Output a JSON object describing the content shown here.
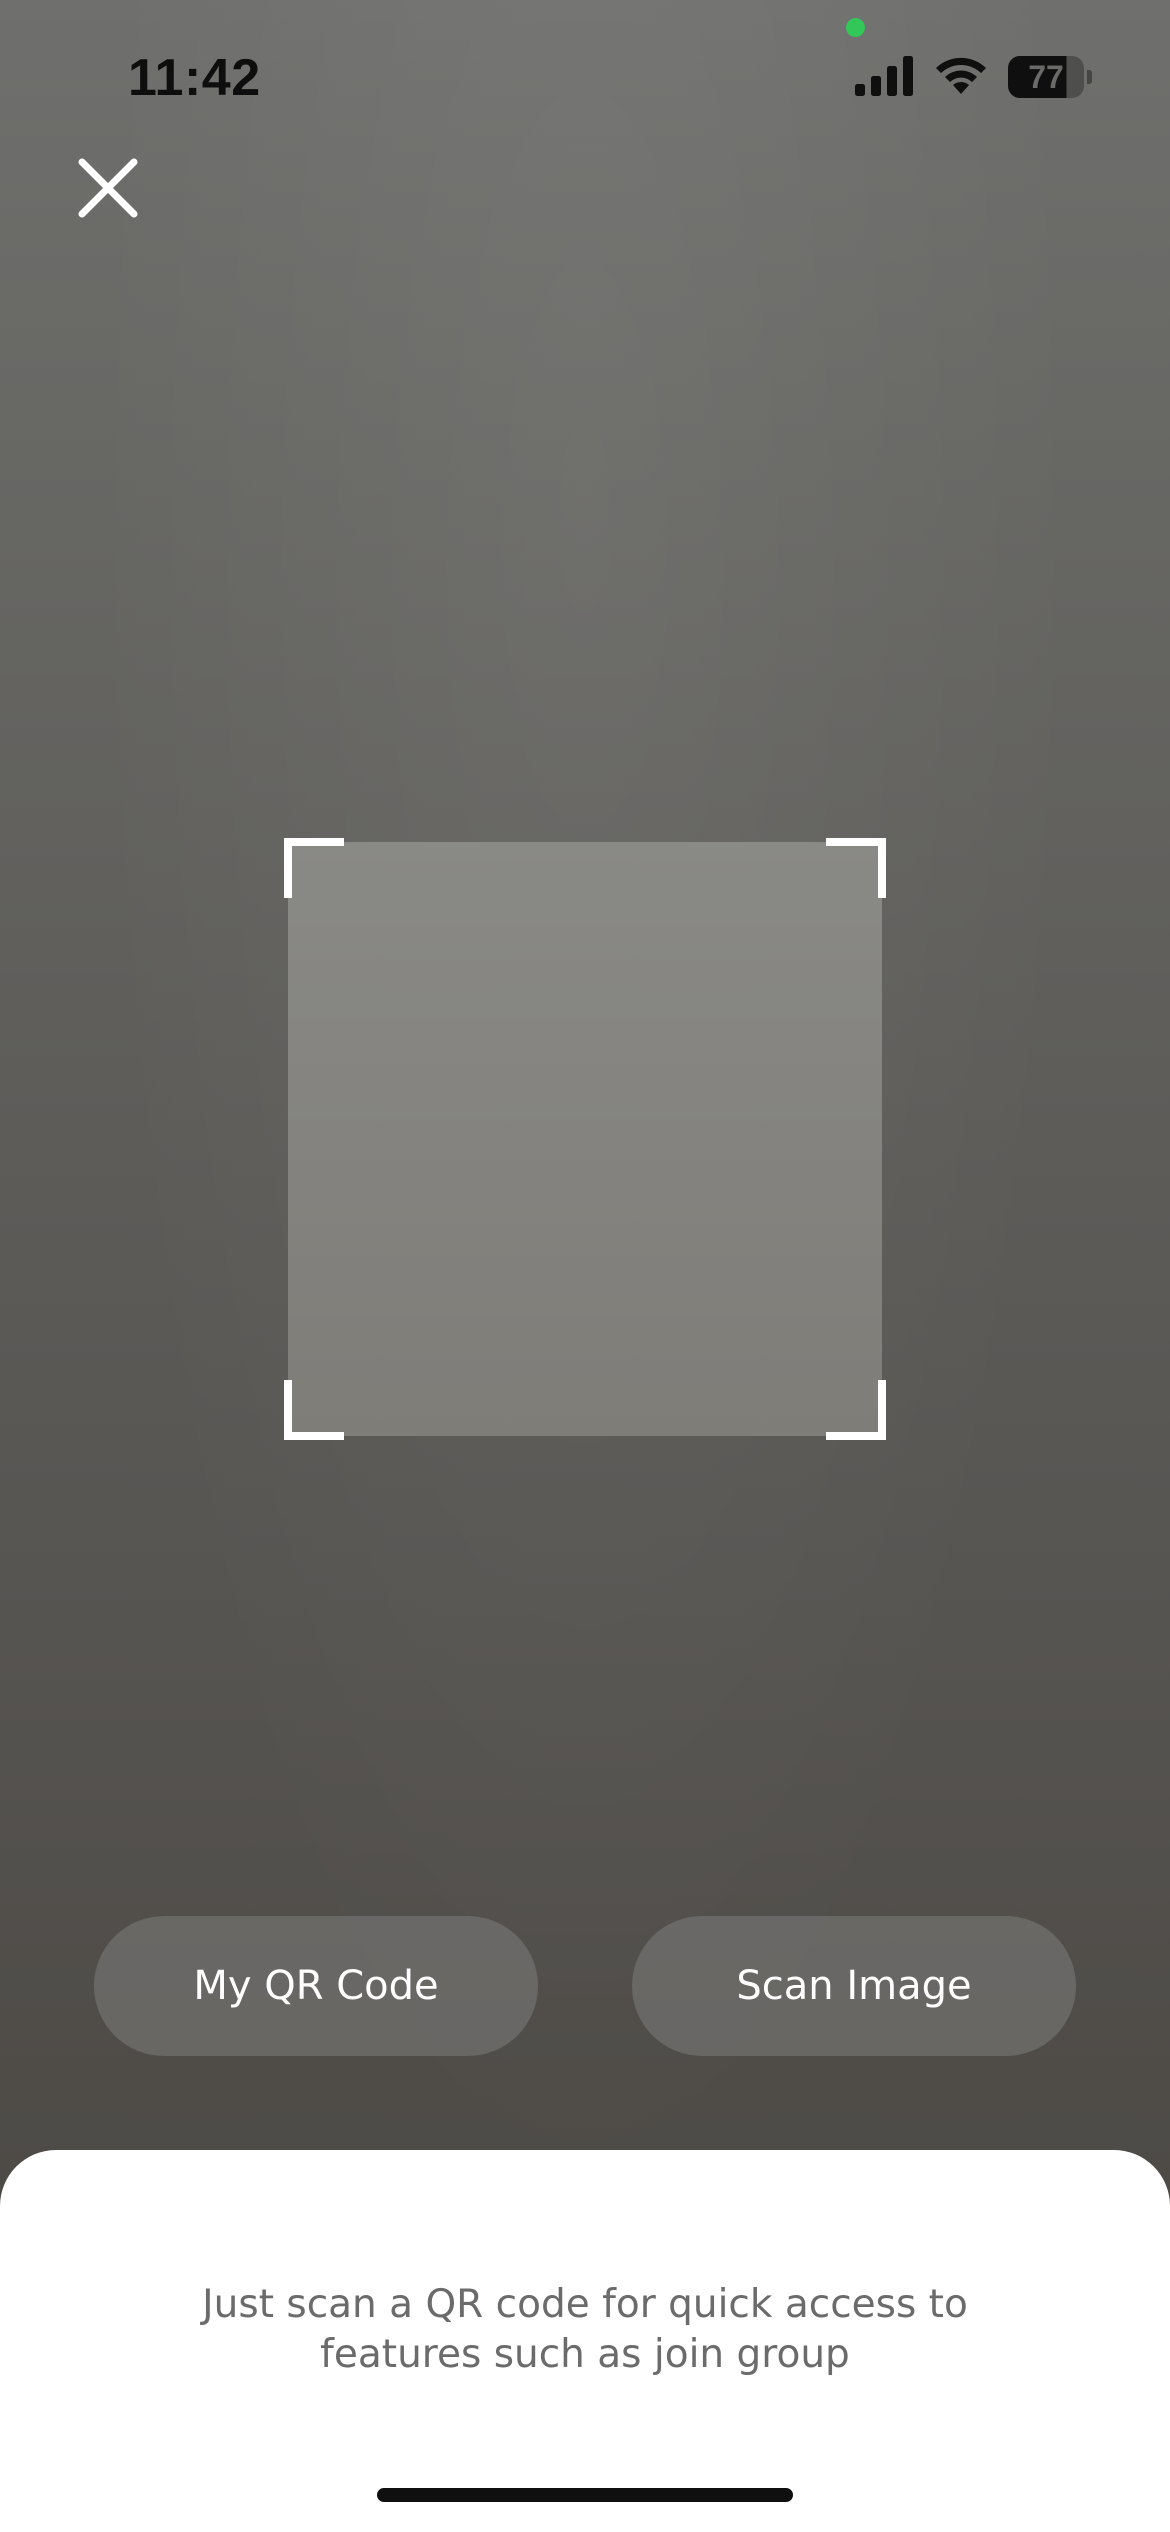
{
  "status_bar": {
    "time": "11:42",
    "battery_level": "77",
    "battery_fraction": 0.77,
    "icons": [
      "signal-icon",
      "wifi-icon",
      "battery-icon"
    ],
    "privacy_indicator_color": "#33c759"
  },
  "header": {
    "close_icon": "close-icon"
  },
  "scanner": {
    "frame_color": "#ffffff"
  },
  "actions": {
    "my_qr_code_label": "My QR Code",
    "scan_image_label": "Scan Image"
  },
  "sheet": {
    "message_line1": "Just scan a QR code for quick access to",
    "message_line2": "features such as join group"
  }
}
